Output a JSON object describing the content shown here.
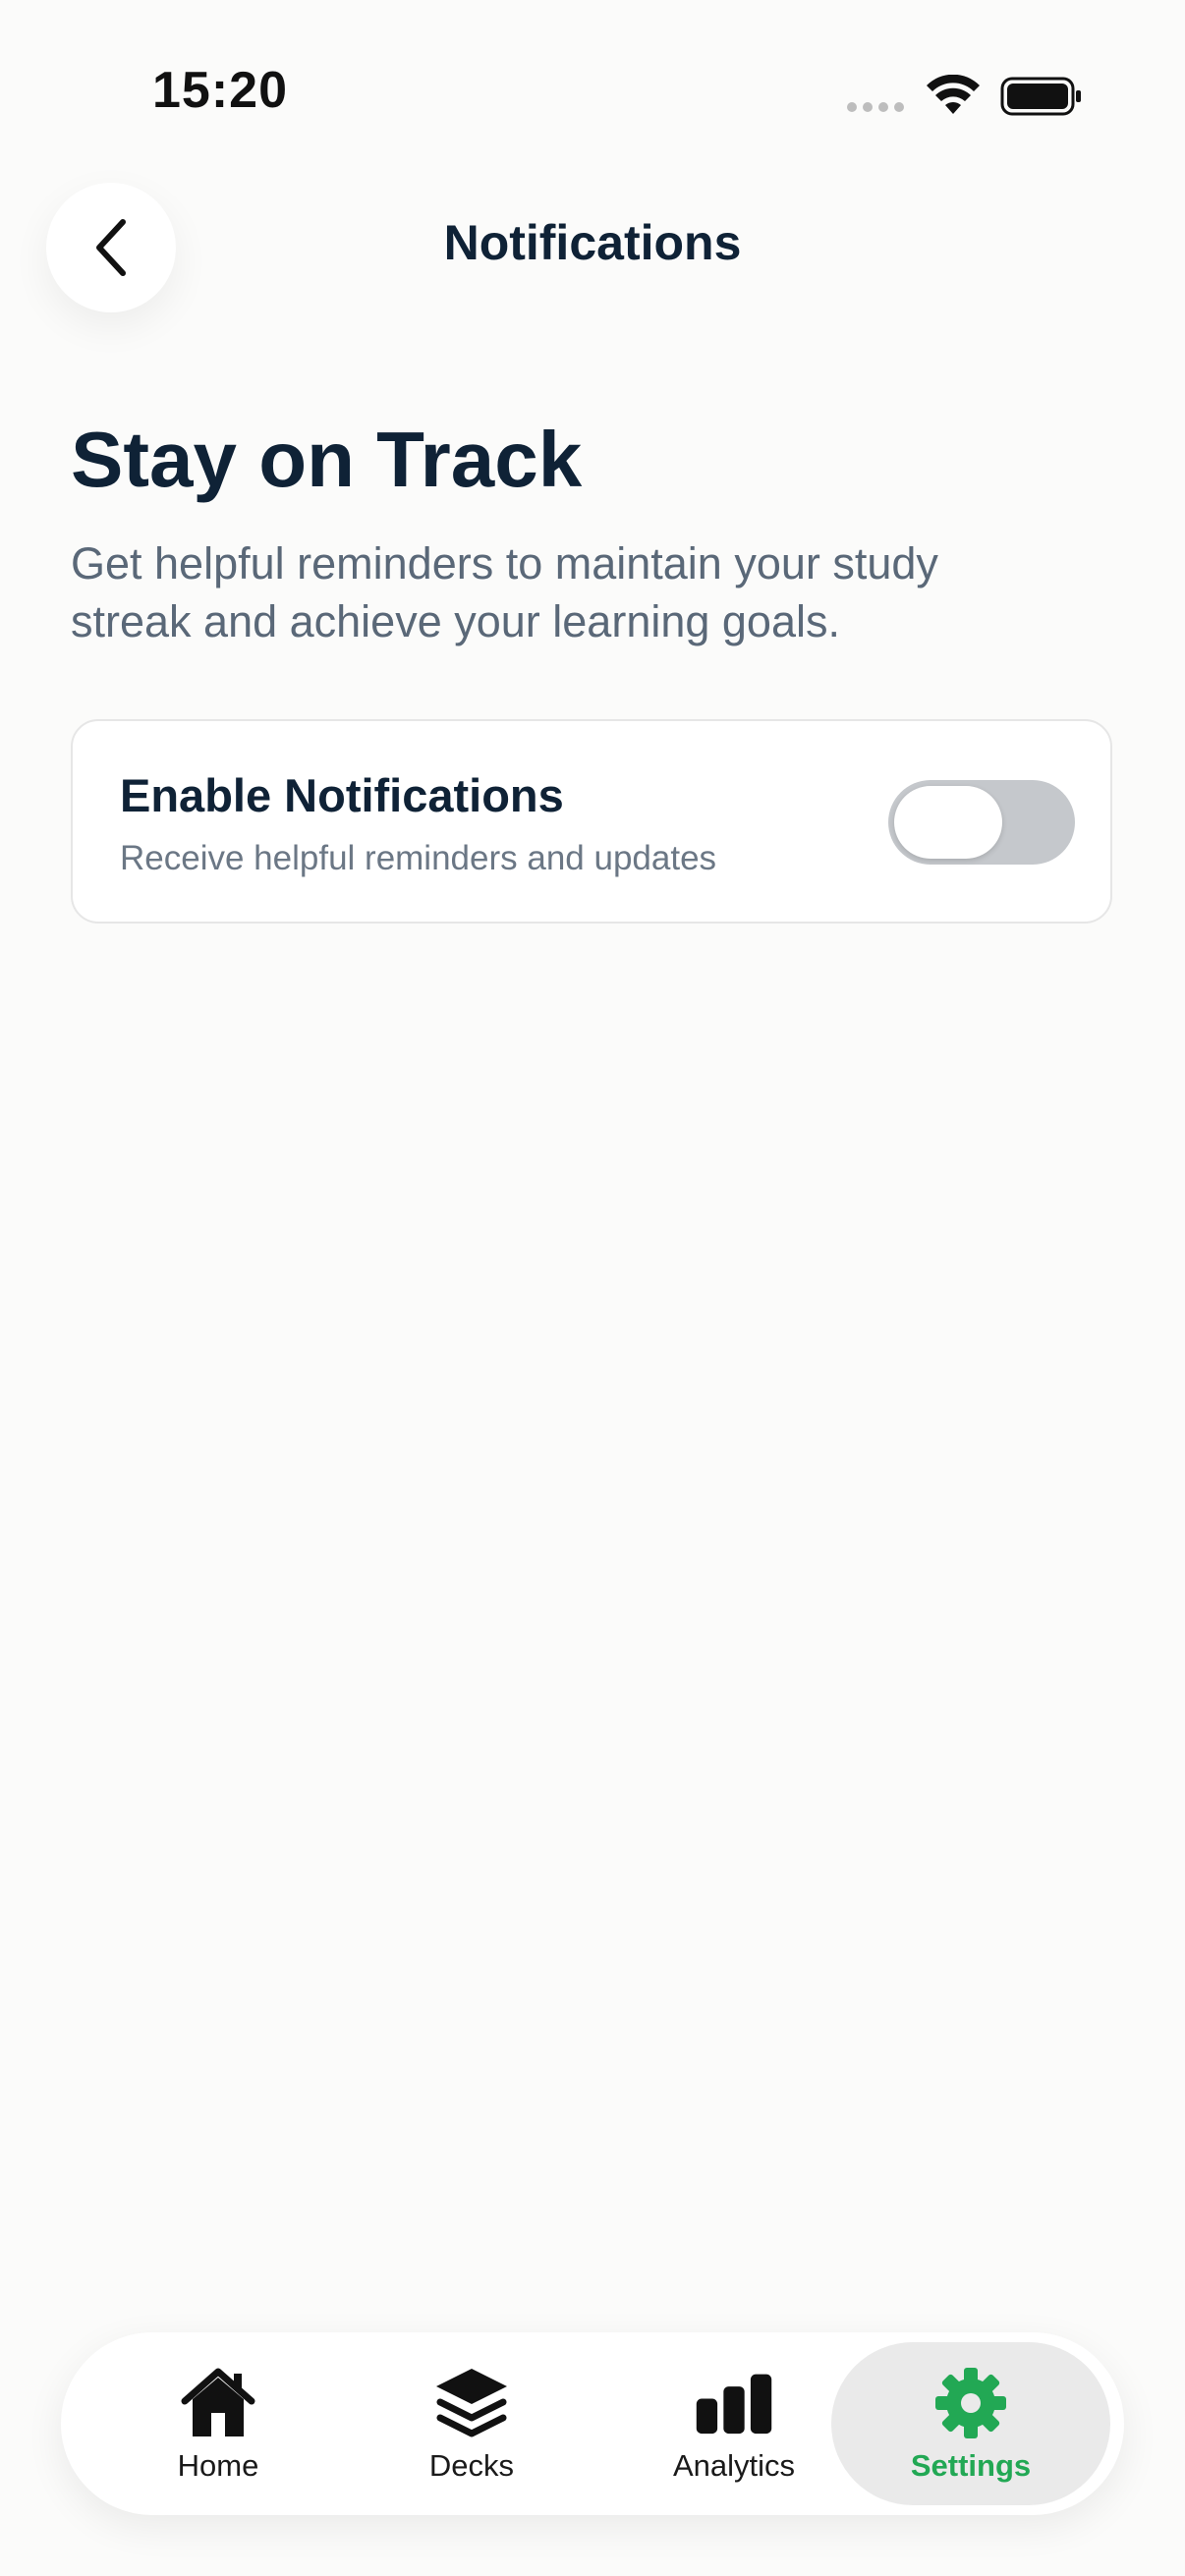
{
  "status_bar": {
    "time": "15:20"
  },
  "header": {
    "title": "Notifications",
    "back_icon": "chevron-left-icon"
  },
  "hero": {
    "heading": "Stay on Track",
    "subtitle": "Get helpful reminders to maintain your study streak and achieve your learning goals."
  },
  "notifications_card": {
    "title": "Enable Notifications",
    "description": "Receive helpful reminders and updates",
    "toggle_on": false
  },
  "tab_bar": {
    "items": [
      {
        "label": "Home",
        "icon": "house-icon",
        "active": false
      },
      {
        "label": "Decks",
        "icon": "stack-icon",
        "active": false
      },
      {
        "label": "Analytics",
        "icon": "bar-chart-icon",
        "active": false
      },
      {
        "label": "Settings",
        "icon": "gear-icon",
        "active": true
      }
    ]
  },
  "colors": {
    "accent": "#22A854",
    "text_primary": "#0F2236",
    "text_secondary": "#5A6878",
    "toggle_off": "#C5C8CC",
    "background": "#FBFBFA"
  }
}
